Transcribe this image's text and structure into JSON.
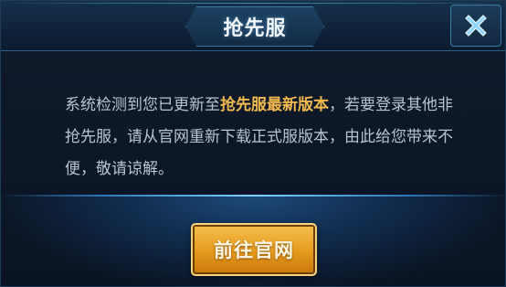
{
  "dialog": {
    "title": "抢先服",
    "close_icon": "close-icon",
    "message": {
      "prefix": "系统检测到您已更新至",
      "highlight": "抢先服最新版本",
      "suffix": "，若要登录其他非抢先服，请从官网重新下载正式服版本，由此给您带来不便，敬请谅解。"
    },
    "primary_button": {
      "label": "前往官网"
    }
  },
  "colors": {
    "accent": "#f2b94f",
    "text": "#b9c4cf",
    "background": "#0c1626",
    "close_icon": "#8fd3ff"
  }
}
